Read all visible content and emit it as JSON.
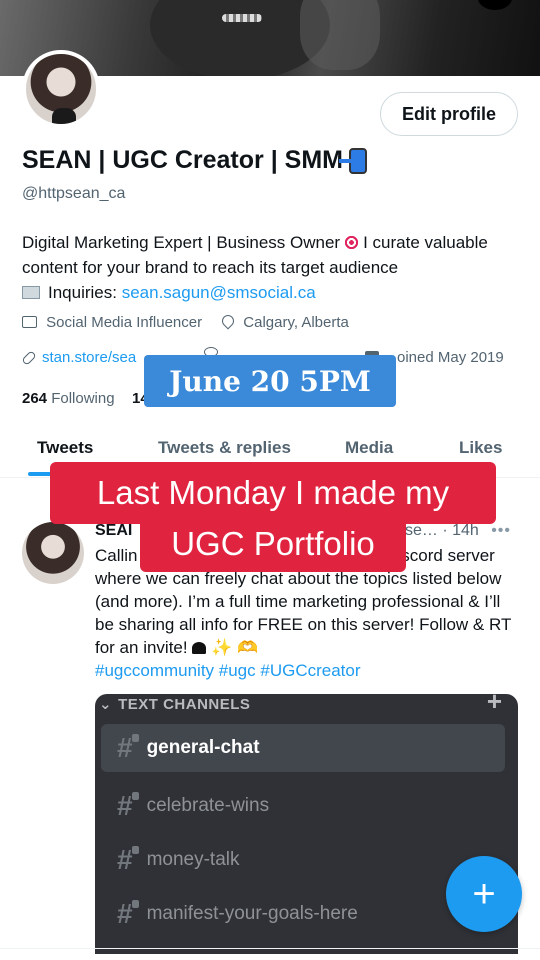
{
  "profile": {
    "edit_label": "Edit profile",
    "name": "SEAN | UGC Creator | SMM",
    "handle": "@httpsean_ca",
    "bio_part1": "Digital Marketing Expert | Business Owner",
    "bio_part2": "I curate valuable content for your brand to reach its target audience",
    "inquiries_label": "Inquiries: ",
    "email": "sean.sagun@smsocial.ca",
    "category": "Social Media Influencer",
    "location": "Calgary, Alberta",
    "website": "stan.store/sea",
    "joined": "oined May 2019",
    "following_count": "264",
    "following_label": "Following",
    "followers_count": "14"
  },
  "overlays": {
    "date": "June 20 5PM",
    "caption_line1": "Last Monday I made my",
    "caption_line2": "UGC Portfolio"
  },
  "tabs": [
    {
      "label": "Tweets"
    },
    {
      "label": "Tweets & replies"
    },
    {
      "label": "Media"
    },
    {
      "label": "Likes"
    }
  ],
  "tweet": {
    "name": "SEAI",
    "time": "se… · 14h",
    "more": "•••",
    "line1": "Callin",
    "line1_end": "iscord server",
    "body": "where we can freely chat about the topics listed below (and more). I’m a full time marketing professional & I’ll be sharing all info for FREE on this server! Follow & RT for an invite!",
    "hashtags": "#ugccommunity #ugc #UGCcreator"
  },
  "discord": {
    "header": "TEXT CHANNELS",
    "plus": "+",
    "channels": [
      {
        "label": "general-chat"
      },
      {
        "label": "celebrate-wins"
      },
      {
        "label": "money-talk"
      },
      {
        "label": "manifest-your-goals-here"
      }
    ]
  },
  "fab": {
    "label": "+"
  },
  "colors": {
    "accent": "#1d9bf0",
    "overlay_red": "#e0233f",
    "overlay_blue": "#3b8ad9",
    "discord_bg": "#2f3136"
  }
}
